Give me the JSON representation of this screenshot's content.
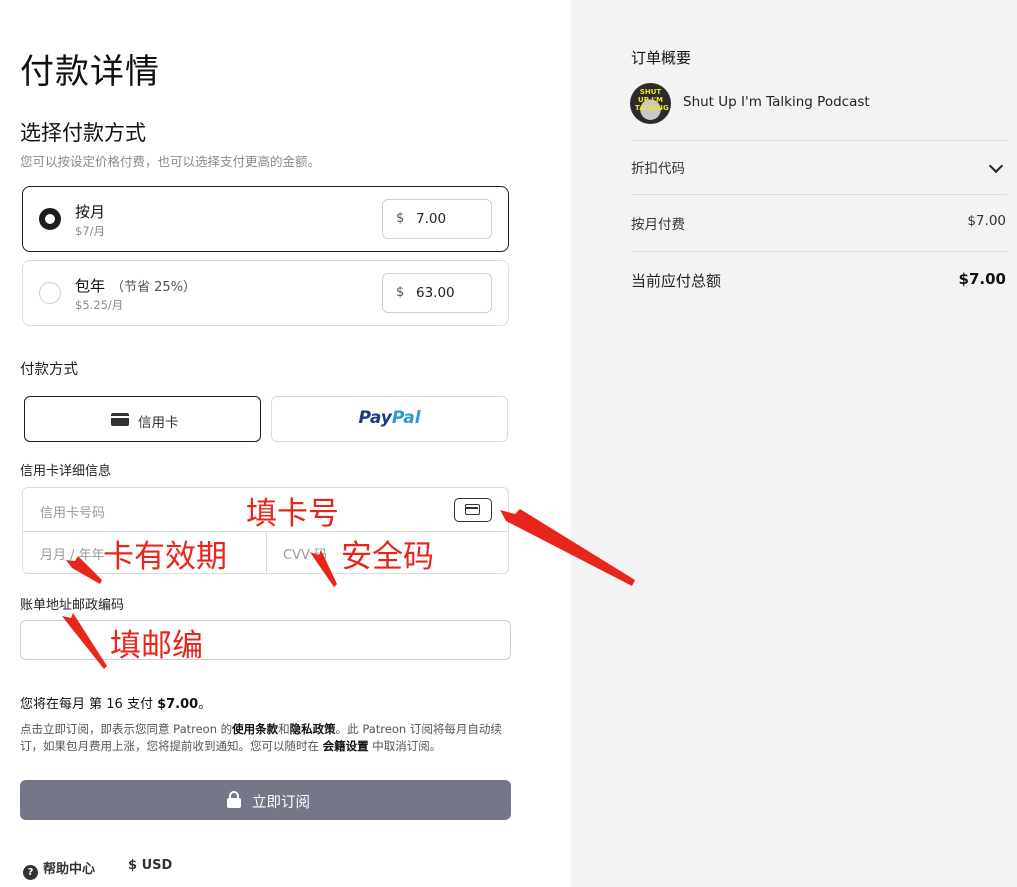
{
  "checkout": {
    "title": "付款详情",
    "plan_section_title": "选择付款方式",
    "plan_section_sub": "您可以按设定价格付费，也可以选择支付更高的金额。",
    "plans": [
      {
        "name": "按月",
        "save": "",
        "sub": "$7/月",
        "currency": "$",
        "amount": "7.00",
        "selected": true
      },
      {
        "name": "包年",
        "save": "（节省 25%）",
        "sub": "$5.25/月",
        "currency": "$",
        "amount": "63.00",
        "selected": false
      }
    ],
    "payment_method_label": "付款方式",
    "payment_methods": {
      "card_label": "信用卡",
      "paypal_part1": "Pay",
      "paypal_part2": "Pal"
    },
    "card_details_label": "信用卡详细信息",
    "card_number_placeholder": "信用卡号码",
    "expiry_placeholder": "月月 / 年年",
    "cvv_placeholder": "CVV 码",
    "zip_label": "账单地址邮政编码",
    "zip_value": "",
    "charge_pre": "您将在每月 第 16 支付 ",
    "charge_amount": "$7.00",
    "charge_post": "。",
    "terms_1": "点击立即订阅，即表示您同意 Patreon 的",
    "terms_link_1": "使用条款",
    "terms_2": "和",
    "terms_link_2": "隐私政策",
    "terms_3": "。此 Patreon 订阅将每月自动续订，如果包月费用上涨，您将提前收到通知。您可以随时在 ",
    "terms_link_3": "会籍设置",
    "terms_4": " 中取消订阅。",
    "subscribe_label": "立即订阅",
    "help_label": "帮助中心",
    "currency_label": "$ USD"
  },
  "annotations": {
    "card_number": "填卡号",
    "expiry": "卡有效期",
    "cvv": "安全码",
    "zip": "填邮编"
  },
  "summary": {
    "title": "订单概要",
    "avatar_text": "SHUT UP I'M TALKING",
    "creator": "Shut Up I'm Talking Podcast",
    "discount_label": "折扣代码",
    "monthly_label": "按月付费",
    "monthly_value": "$7.00",
    "total_label": "当前应付总额",
    "total_value": "$7.00"
  },
  "colors": {
    "annotation": "#e8251a",
    "subscribe_bg": "#737787",
    "summary_bg": "#f3f3f4"
  }
}
